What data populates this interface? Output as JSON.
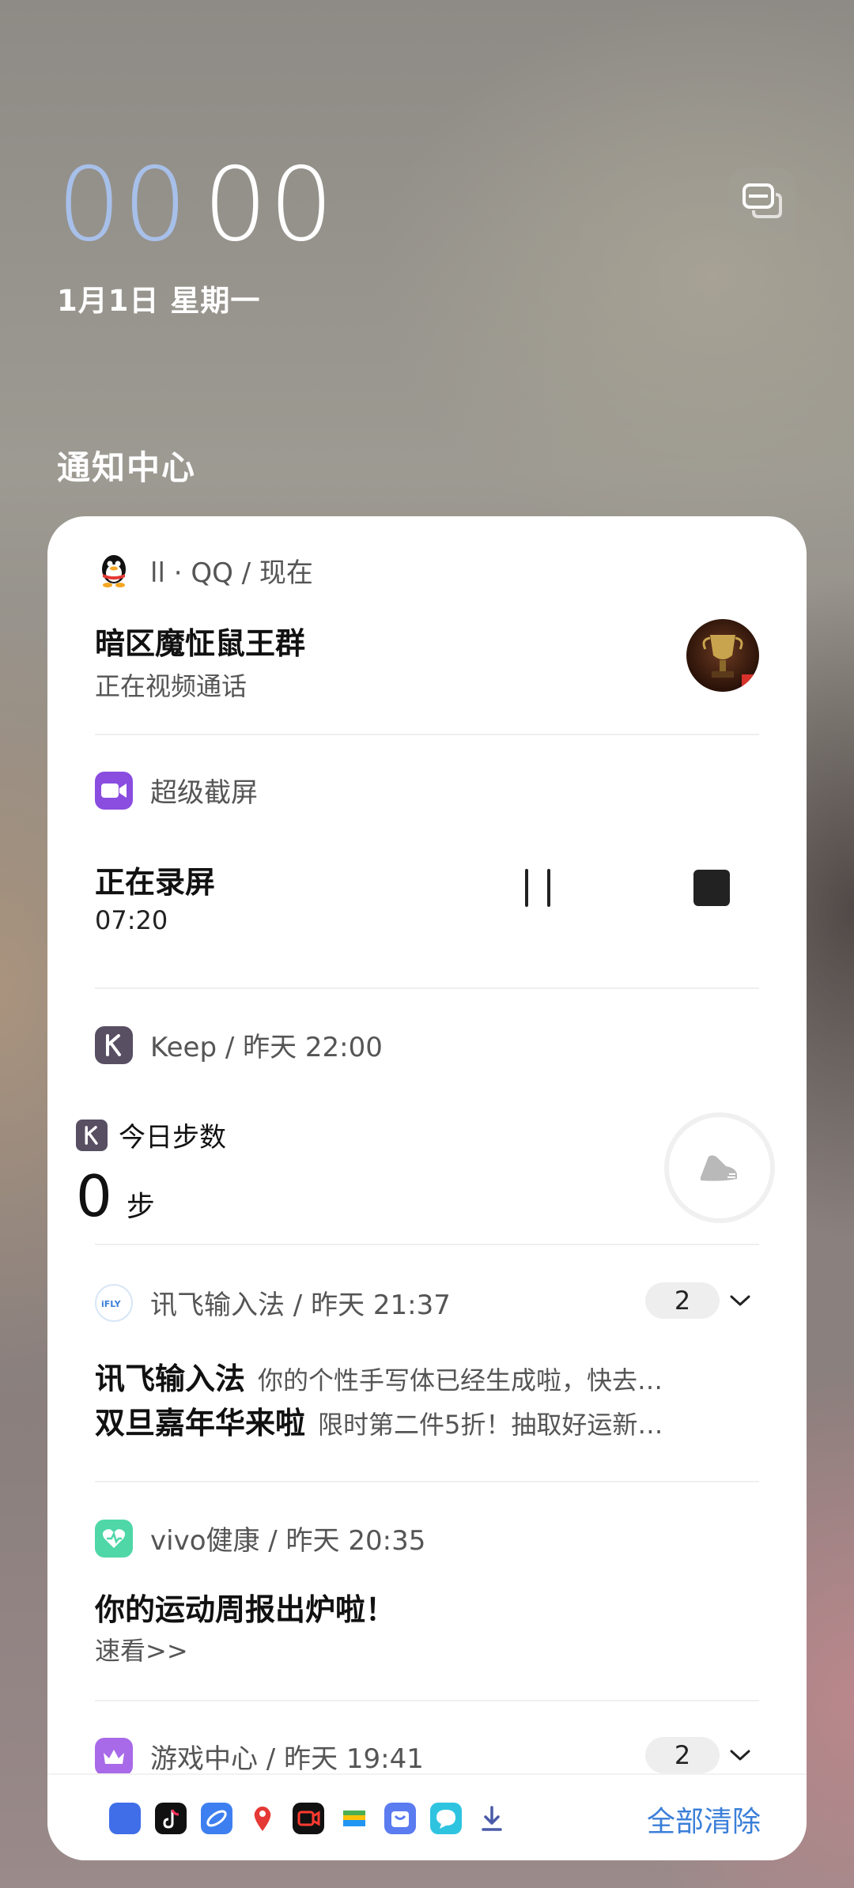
{
  "lockscreen": {
    "clock_hours": "00",
    "clock_minutes": "00",
    "date": "1月1日 星期一"
  },
  "notification_center": {
    "title": "通知中心"
  },
  "notifications": {
    "qq": {
      "header": "ll · QQ / 现在",
      "title": "暗区魔怔鼠王群",
      "subtitle": "正在视频通话"
    },
    "screen_record": {
      "app_name": "超级截屏",
      "title": "正在录屏",
      "time": "07:20"
    },
    "keep": {
      "header": "Keep / 昨天 22:00",
      "widget_label": "今日步数",
      "steps": "0",
      "steps_unit": "步"
    },
    "ifly": {
      "header": "讯飞输入法 / 昨天 21:37",
      "count": "2",
      "messages": [
        {
          "title": "讯飞输入法",
          "text": "你的个性手写体已经生成啦，快去…"
        },
        {
          "title": "双旦嘉年华来啦",
          "text": "限时第二件5折！抽取好运新…"
        }
      ]
    },
    "vivo_health": {
      "header": "vivo健康 / 昨天 20:35",
      "title": "你的运动周报出炉啦！",
      "subtitle": "速看>>"
    },
    "game_center": {
      "header": "游戏中心 / 昨天 19:41",
      "count": "2"
    }
  },
  "dock": {
    "clear_all": "全部清除",
    "icons": [
      "app-icon",
      "tiktok-icon",
      "browser-icon",
      "baidu-map-icon",
      "camera-icon",
      "wallet-icon",
      "store-icon",
      "message-icon",
      "download-icon"
    ]
  },
  "colors": {
    "clock_hours": "#a9c3f0",
    "accent_blue": "#3b7fd9",
    "screen_record": "#8a4de0",
    "keep": "#584f63",
    "vivo_health": "#4fd7a8",
    "game_center": "#a86ae8"
  }
}
